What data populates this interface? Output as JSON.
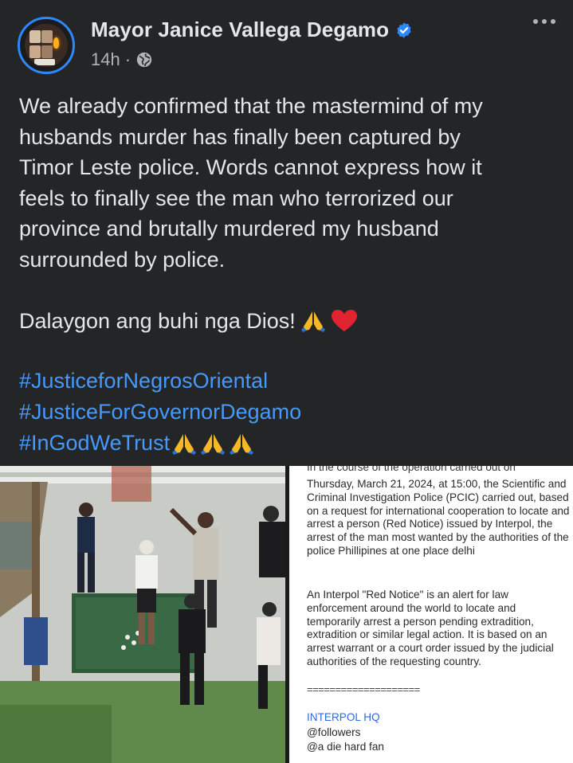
{
  "post": {
    "author": "Mayor Janice Vallega Degamo",
    "time": "14h",
    "separator": "·",
    "body_lines": [
      "We already confirmed that the mastermind of my",
      "husbands murder has finally been captured by",
      "Timor Leste police. Words cannot express how it",
      "feels to finally see the man who terrorized our",
      "province and brutally murdered my husband",
      "surrounded by police."
    ],
    "closing": "Dalaygon ang buhi nga Dios!",
    "hashtags": [
      "#JusticeforNegrosOriental",
      "#JusticeForGovernorDegamo",
      "#InGodWeTrust"
    ],
    "icons": {
      "verified": "verified-badge-icon",
      "privacy": "globe-icon",
      "more": "more-options-icon",
      "pray": "folded-hands-emoji",
      "heart": "red-heart-emoji"
    }
  },
  "document": {
    "cut_top_line": "In the course of the operation carried out on",
    "paragraph1": "Thursday, March 21, 2024, at 15:00, the Scientific and Criminal Investigation Police (PCIC) carried out, based on a request for international cooperation to locate and arrest a person (Red Notice) issued by Interpol, the arrest of the man most wanted by the authorities of the police Phillipines at one place delhi",
    "paragraph2": "An Interpol \"Red Notice\" is an alert for law enforcement around the world to locate and temporarily arrest a person pending extradition, extradition or similar legal action. It is based on an arrest warrant or a court order issued by the judicial authorities of the requesting country.",
    "separator": "====================",
    "source": "INTERPOL HQ",
    "footer1": "@followers",
    "footer2": "@a die hard fan"
  },
  "colors": {
    "background": "#242526",
    "text": "#e4e6eb",
    "muted": "#b0b3b8",
    "link": "#4599ff",
    "verified": "#2d88ff"
  }
}
